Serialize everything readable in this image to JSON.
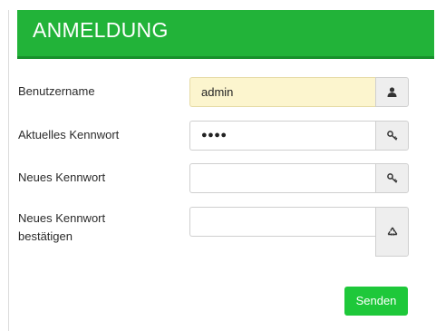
{
  "header": {
    "title": "ANMELDUNG"
  },
  "form": {
    "username": {
      "label": "Benutzername",
      "value": "admin",
      "icon": "user-icon"
    },
    "current_password": {
      "label": "Aktuelles Kennwort",
      "value": "●●●●",
      "icon": "key-icon"
    },
    "new_password": {
      "label": "Neues Kennwort",
      "value": "",
      "icon": "key-icon"
    },
    "confirm_password": {
      "label_line1": "Neues Kennwort",
      "label_line2": "bestätigen",
      "value": "",
      "icon": "recycle-icon"
    }
  },
  "actions": {
    "submit_label": "Senden"
  },
  "colors": {
    "header_bg": "#22b339",
    "button_bg": "#1ec83a",
    "autofill_bg": "#fcf5ce"
  }
}
